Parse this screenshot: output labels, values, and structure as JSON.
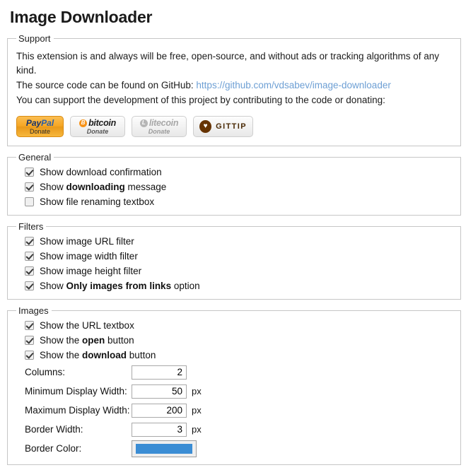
{
  "page_title": "Image Downloader",
  "support": {
    "legend": "Support",
    "line1": "This extension is and always will be free, open-source, and without ads or tracking algorithms of any kind.",
    "line2_prefix": "The source code can be found on GitHub: ",
    "link_text": "https://github.com/vdsabev/image-downloader",
    "link_color": "#6d9fd4",
    "line3": "You can support the development of this project by contributing to the code or donating:",
    "donate_buttons": [
      {
        "name": "paypal-donate-button",
        "brand": "PayPal",
        "brand_part1": "Pay",
        "brand_part2": "Pal",
        "sub": "Donate",
        "color": "#f5a623"
      },
      {
        "name": "bitcoin-donate-button",
        "brand": "bitcoin",
        "mark": "B",
        "sub": "Donate",
        "color": "#f7931a"
      },
      {
        "name": "litecoin-donate-button",
        "brand": "litecoin",
        "mark": "L",
        "sub": "Donate",
        "color": "#b6b6b6"
      },
      {
        "name": "gittip-donate-button",
        "brand": "GITTIP",
        "icon": "heart-icon",
        "glyph": "♥",
        "color": "#663300"
      }
    ]
  },
  "general": {
    "legend": "General",
    "options": [
      {
        "checked": true,
        "pre": "Show download confirmation",
        "bold": "",
        "post": ""
      },
      {
        "checked": true,
        "pre": "Show ",
        "bold": "downloading",
        "post": " message"
      },
      {
        "checked": false,
        "pre": "Show file renaming textbox",
        "bold": "",
        "post": ""
      }
    ]
  },
  "filters": {
    "legend": "Filters",
    "options": [
      {
        "checked": true,
        "pre": "Show image URL filter",
        "bold": "",
        "post": ""
      },
      {
        "checked": true,
        "pre": "Show image width filter",
        "bold": "",
        "post": ""
      },
      {
        "checked": true,
        "pre": "Show image height filter",
        "bold": "",
        "post": ""
      },
      {
        "checked": true,
        "pre": "Show ",
        "bold": "Only images from links",
        "post": " option"
      }
    ]
  },
  "images": {
    "legend": "Images",
    "options": [
      {
        "checked": true,
        "pre": "Show the URL textbox",
        "bold": "",
        "post": ""
      },
      {
        "checked": true,
        "pre": "Show the ",
        "bold": "open",
        "post": " button"
      },
      {
        "checked": true,
        "pre": "Show the ",
        "bold": "download",
        "post": " button"
      }
    ],
    "fields": [
      {
        "label": "Columns:",
        "value": "2",
        "unit": ""
      },
      {
        "label": "Minimum Display Width:",
        "value": "50",
        "unit": "px"
      },
      {
        "label": "Maximum Display Width:",
        "value": "200",
        "unit": "px"
      },
      {
        "label": "Border Width:",
        "value": "3",
        "unit": "px"
      }
    ],
    "border_color": {
      "label": "Border Color:",
      "value": "#3b8dd4"
    }
  }
}
